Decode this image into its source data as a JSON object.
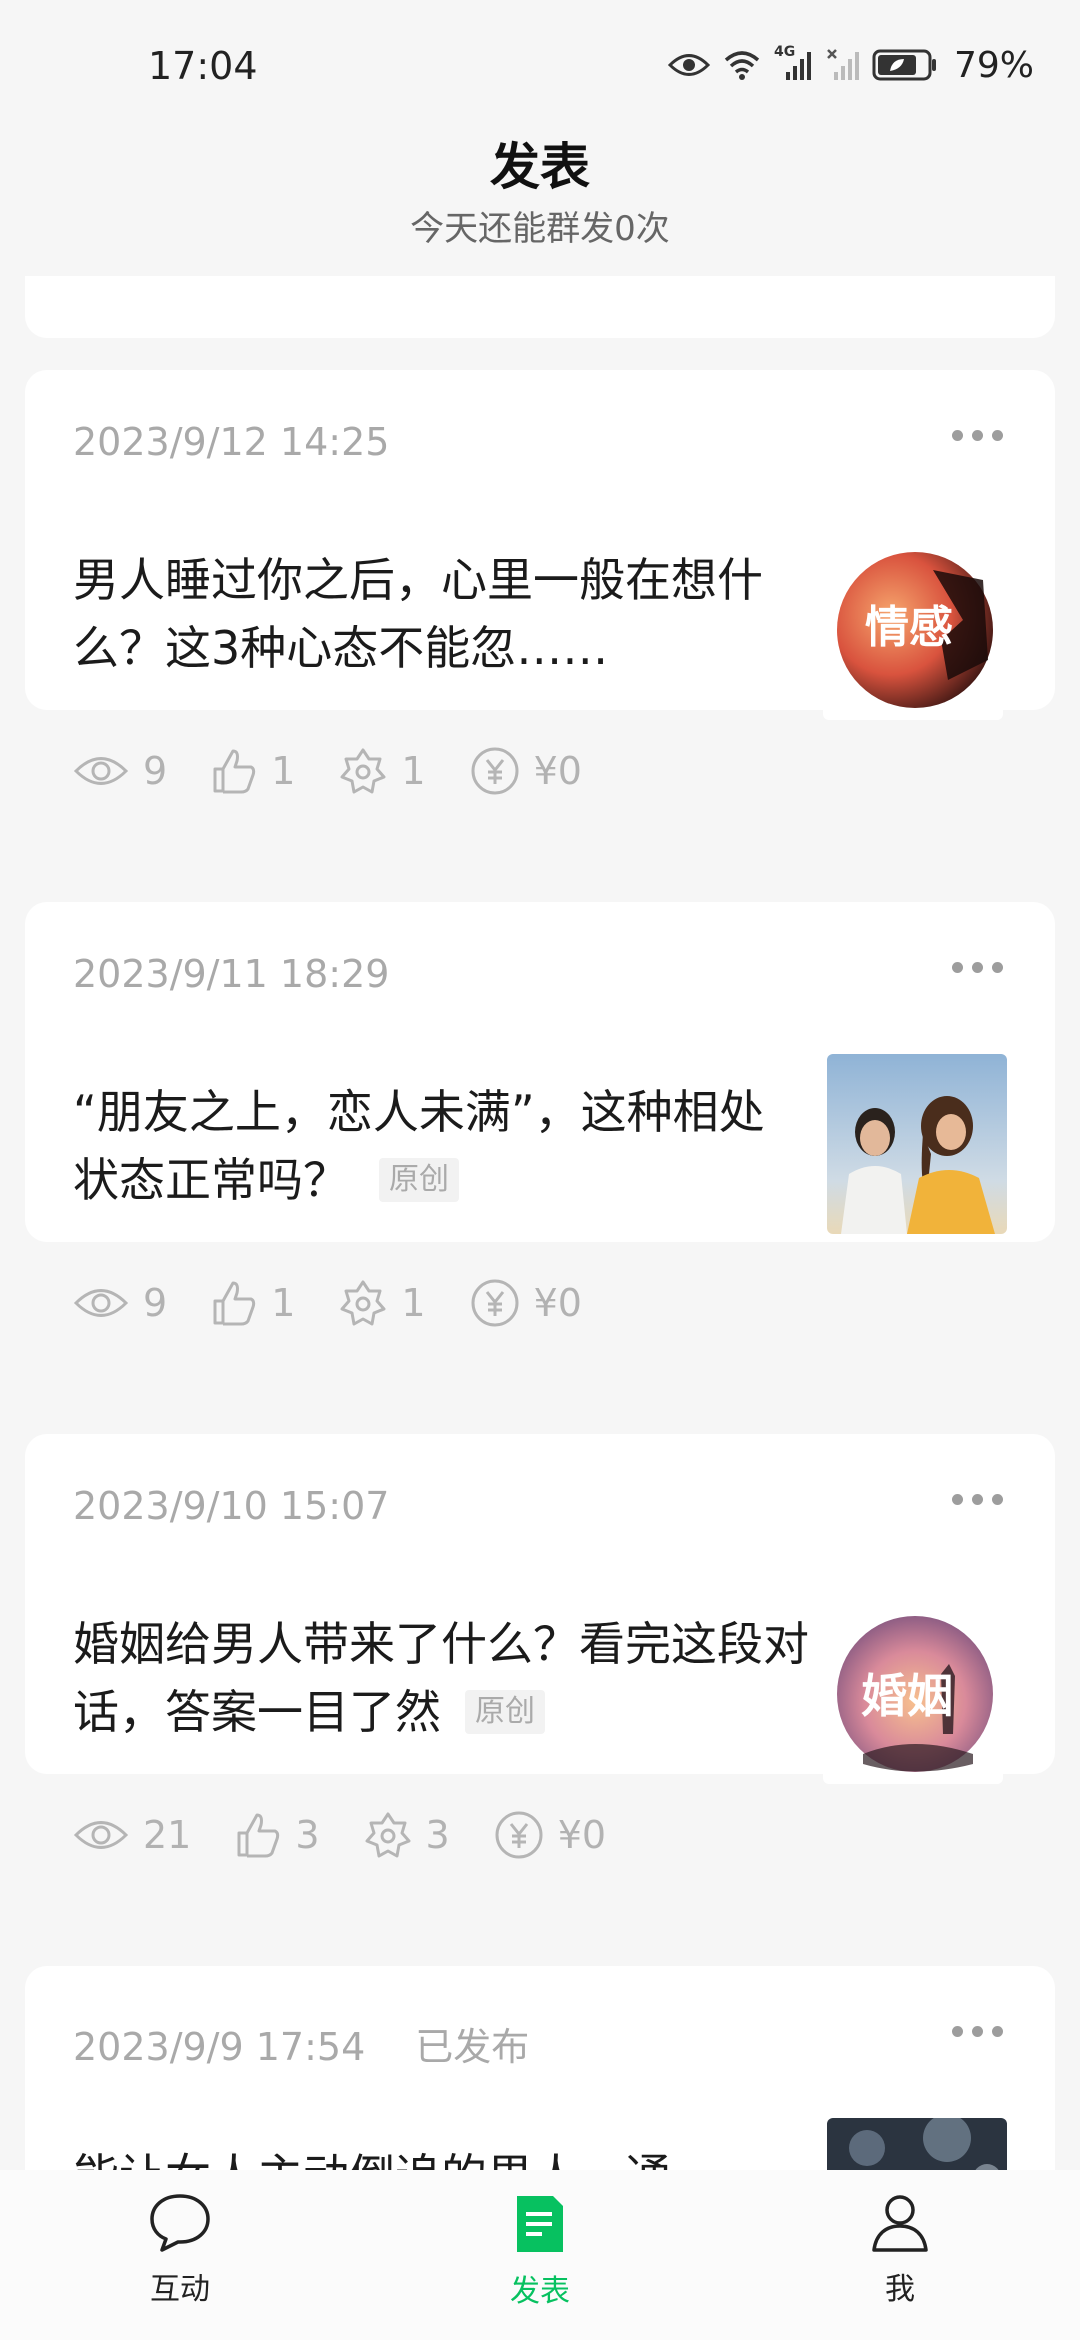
{
  "status_bar": {
    "time": "17:04",
    "network": "4G",
    "battery": "79%"
  },
  "header": {
    "title": "发表",
    "subtitle": "今天还能群发0次"
  },
  "posts": [
    {
      "date": "2023/9/12 14:25",
      "status": "",
      "title": "男人睡过你之后，心里一般在想什么？这3种心态不能忽……",
      "tag": "",
      "thumb_text": "情感",
      "views": "9",
      "likes": "1",
      "shares": "1",
      "reward": "¥0"
    },
    {
      "date": "2023/9/11 18:29",
      "status": "",
      "title": "“朋友之上，恋人未满”，这种相处状态正常吗？",
      "tag": "原创",
      "thumb_text": "",
      "views": "9",
      "likes": "1",
      "shares": "1",
      "reward": "¥0"
    },
    {
      "date": "2023/9/10 15:07",
      "status": "",
      "title": "婚姻给男人带来了什么？看完这段对话，答案一目了然",
      "tag": "原创",
      "thumb_text": "婚姻",
      "views": "21",
      "likes": "3",
      "shares": "3",
      "reward": "¥0"
    },
    {
      "date": "2023/9/9 17:54",
      "status": "已发布",
      "title": "能让女人主动倒追的男人，通",
      "tag": "",
      "thumb_text": "",
      "views": "",
      "likes": "",
      "shares": "",
      "reward": ""
    }
  ],
  "bottom_nav": {
    "items": [
      {
        "label": "互动",
        "icon": "chat-bubble-icon"
      },
      {
        "label": "发表",
        "icon": "document-icon"
      },
      {
        "label": "我",
        "icon": "person-icon"
      }
    ],
    "active_index": 1
  },
  "colors": {
    "accent": "#07c160",
    "background": "#f6f6f6",
    "card": "#ffffff",
    "meta_text": "#a9a9a9"
  }
}
